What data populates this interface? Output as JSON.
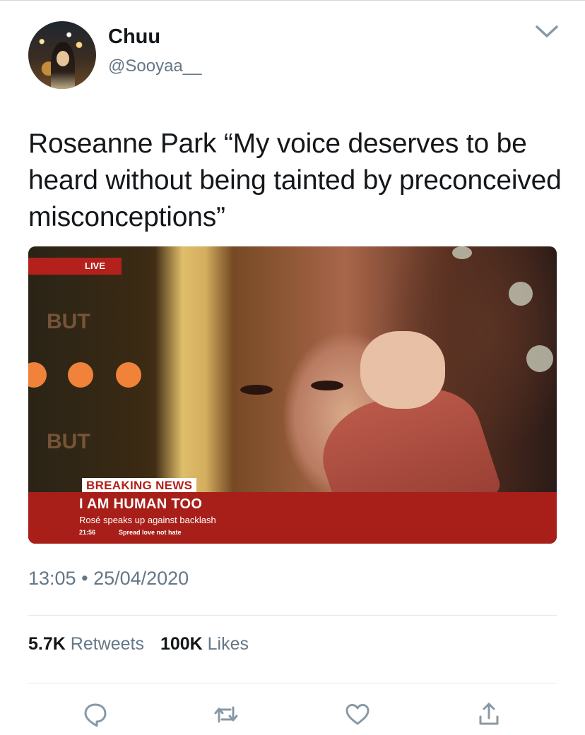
{
  "tweet": {
    "author": {
      "name": "Chuu",
      "handle": "@Sooyaa__"
    },
    "text": "Roseanne Park “My voice deserves to be heard without being tainted by preconceived misconceptions”",
    "media": {
      "live_label": "LIVE",
      "ghost_text": "BUT",
      "breaking_label": "BREAKING NEWS",
      "headline": "I AM HUMAN TOO",
      "subline": "Rosé speaks up against backlash",
      "ticker_time": "21:56",
      "ticker_text": "Spread love not hate"
    },
    "time": "13:05",
    "separator": "•",
    "date": "25/04/2020",
    "stats": {
      "retweets_count": "5.7K",
      "retweets_label": "Retweets",
      "likes_count": "100K",
      "likes_label": "Likes"
    }
  },
  "icons": {
    "more": "chevron-down-icon",
    "reply": "reply-icon",
    "retweet": "retweet-icon",
    "like": "heart-icon",
    "share": "share-icon"
  },
  "colors": {
    "text_primary": "#14171a",
    "text_secondary": "#657786",
    "icon_gray": "#8899a6",
    "divider": "#e1e8ed",
    "news_red": "#a81f1a"
  }
}
